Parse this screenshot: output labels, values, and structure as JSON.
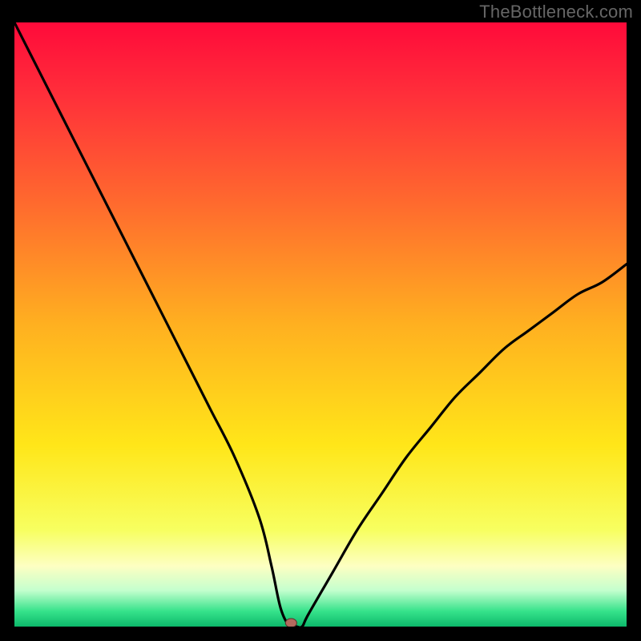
{
  "watermark": "TheBottleneck.com",
  "chart_data": {
    "type": "line",
    "title": "",
    "xlabel": "",
    "ylabel": "",
    "xlim": [
      0,
      100
    ],
    "ylim": [
      0,
      100
    ],
    "x": [
      0,
      4,
      8,
      12,
      16,
      20,
      24,
      28,
      32,
      36,
      40,
      42,
      43.5,
      45,
      46,
      47,
      48,
      52,
      56,
      60,
      64,
      68,
      72,
      76,
      80,
      84,
      88,
      92,
      96,
      100
    ],
    "values": [
      100,
      92,
      84,
      76,
      68,
      60,
      52,
      44,
      36,
      28,
      18,
      10,
      3,
      0,
      0,
      0,
      2,
      9,
      16,
      22,
      28,
      33,
      38,
      42,
      46,
      49,
      52,
      55,
      57,
      60
    ],
    "marker": {
      "x": 45.2,
      "y": 0.6,
      "color": "#b36a5e"
    },
    "gradient_stops": [
      {
        "offset": 0.0,
        "color": "#ff0a3a"
      },
      {
        "offset": 0.12,
        "color": "#ff2f3a"
      },
      {
        "offset": 0.3,
        "color": "#ff6a2e"
      },
      {
        "offset": 0.5,
        "color": "#ffb020"
      },
      {
        "offset": 0.7,
        "color": "#ffe619"
      },
      {
        "offset": 0.84,
        "color": "#f7ff60"
      },
      {
        "offset": 0.9,
        "color": "#fdffc2"
      },
      {
        "offset": 0.94,
        "color": "#c4ffce"
      },
      {
        "offset": 0.975,
        "color": "#35e28a"
      },
      {
        "offset": 1.0,
        "color": "#0db86b"
      }
    ]
  }
}
